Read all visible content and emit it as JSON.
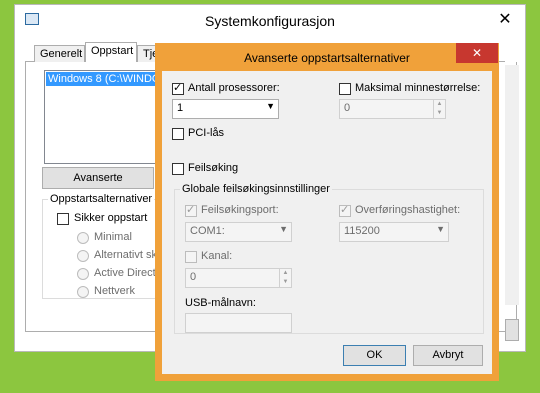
{
  "sys": {
    "title": "Systemkonfigurasjon",
    "close_glyph": "✕",
    "tabs": [
      "Generelt",
      "Oppstart",
      "Tjenester"
    ],
    "os_entry": "Windows 8 (C:\\WINDOWS)",
    "advanced_button": "Avanserte alternativer...",
    "boot_options_group": "Oppstartsalternativer",
    "safe_boot_label": "Sikker oppstart",
    "safe_boot_checked": false,
    "radios": [
      "Minimal",
      "Alternativt skall",
      "Active Directory-reparasjon",
      "Nettverk"
    ]
  },
  "dialog": {
    "title": "Avanserte oppstartsalternativer",
    "close_glyph": "✕",
    "num_processors_label": "Antall prosessorer:",
    "num_processors_checked": true,
    "num_processors_value": "1",
    "max_memory_label": "Maksimal minnestørrelse:",
    "max_memory_checked": false,
    "max_memory_value": "0",
    "pci_lock_label": "PCI-lås",
    "pci_lock_checked": false,
    "debug_label": "Feilsøking",
    "debug_checked": false,
    "global_debug_group": "Globale feilsøkingsinnstillinger",
    "debug_port_label": "Feilsøkingsport:",
    "debug_port_checked": true,
    "debug_port_value": "COM1:",
    "baud_rate_label": "Overføringshastighet:",
    "baud_rate_checked": true,
    "baud_rate_value": "115200",
    "channel_label": "Kanal:",
    "channel_checked": false,
    "channel_value": "0",
    "usb_target_label": "USB-målnavn:",
    "usb_target_value": "",
    "ok_label": "OK",
    "cancel_label": "Avbryt"
  }
}
